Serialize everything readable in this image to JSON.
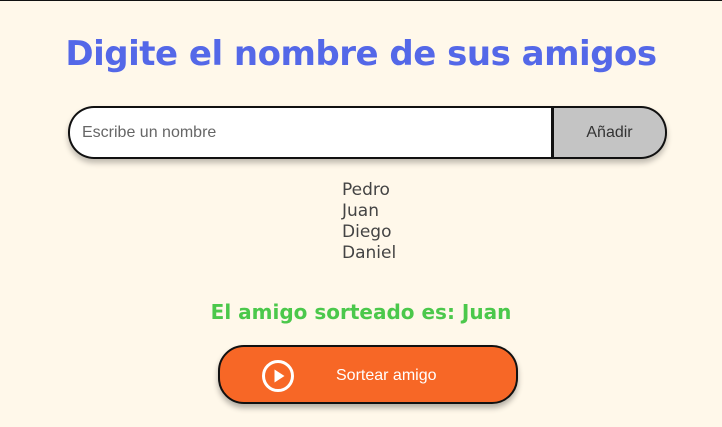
{
  "header": {
    "title": "Digite el nombre de sus amigos"
  },
  "form": {
    "input_value": "",
    "input_placeholder": "Escribe un nombre",
    "add_label": "Añadir"
  },
  "friends": [
    "Pedro",
    "Juan",
    "Diego",
    "Daniel"
  ],
  "result": {
    "text": "El amigo sorteado es: Juan"
  },
  "draw_button": {
    "label": "Sortear amigo",
    "icon": "play-circle-icon"
  },
  "colors": {
    "background": "#FFF8EA",
    "title": "#5468E8",
    "result": "#4BC84B",
    "draw_button": "#F76726",
    "add_button": "#C4C4C4"
  }
}
